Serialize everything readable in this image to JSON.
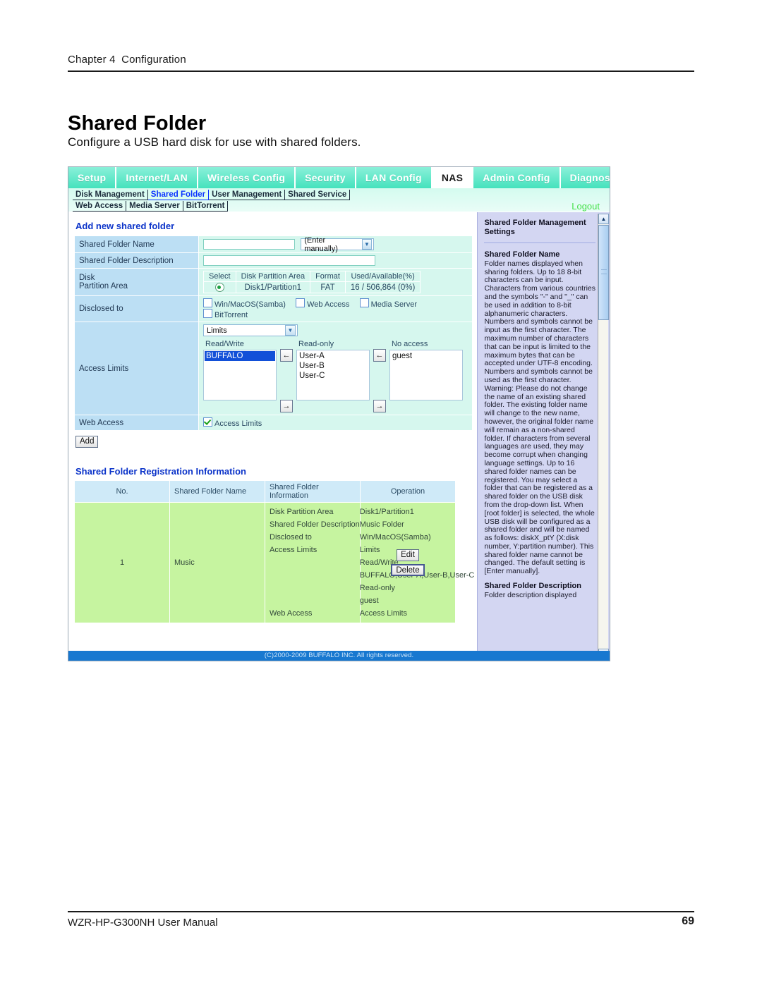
{
  "manual": {
    "running_head_chapter": "Chapter 4",
    "running_head_title": "Configuration",
    "page_title": "Shared Folder",
    "page_subtitle": "Configure a USB hard disk for use with shared folders.",
    "footer_left": "WZR-HP-G300NH User Manual",
    "footer_page": "69"
  },
  "ui": {
    "main_tabs": [
      {
        "label": "Setup",
        "active": false
      },
      {
        "label": "Internet/LAN",
        "active": false
      },
      {
        "label": "Wireless Config",
        "active": false
      },
      {
        "label": "Security",
        "active": false
      },
      {
        "label": "LAN Config",
        "active": false
      },
      {
        "label": "NAS",
        "active": true
      },
      {
        "label": "Admin Config",
        "active": false
      },
      {
        "label": "Diagnostic",
        "active": false
      }
    ],
    "sub_tabs_row1": [
      {
        "label": "Disk Management",
        "active": false
      },
      {
        "label": "Shared Folder",
        "active": true
      },
      {
        "label": "User Management",
        "active": false
      },
      {
        "label": "Shared Service",
        "active": false
      }
    ],
    "sub_tabs_row2": [
      {
        "label": "Web Access",
        "active": false
      },
      {
        "label": "Media Server",
        "active": false
      },
      {
        "label": "BitTorrent",
        "active": false
      }
    ],
    "logout_label": "Logout",
    "copyright": "(C)2000-2009 BUFFALO INC. All rights reserved.",
    "form": {
      "section_title": "Add new shared folder",
      "folder_name_label": "Shared Folder Name",
      "folder_name_value": "",
      "folder_name_select": "(Enter manually)",
      "folder_desc_label": "Shared Folder Description",
      "folder_desc_value": "",
      "disk_label_line1": "Disk",
      "disk_label_line2": "Partition Area",
      "disk_headers": [
        "Select",
        "Disk Partition Area",
        "Format",
        "Used/Available(%)"
      ],
      "disk_row": {
        "partition": "Disk1/Partition1",
        "format": "FAT",
        "used_available": "16 / 506,864 (0%)"
      },
      "disclosed_label": "Disclosed to",
      "disclosed_options": [
        {
          "label": "Win/MacOS(Samba)",
          "checked": false
        },
        {
          "label": "Web Access",
          "checked": false
        },
        {
          "label": "Media Server",
          "checked": false
        },
        {
          "label": "BitTorrent",
          "checked": false
        }
      ],
      "access_limits_label": "Access Limits",
      "access_limits_select": "Limits",
      "col_readwrite": "Read/Write",
      "col_readonly": "Read-only",
      "col_noaccess": "No access",
      "readwrite_list": [
        "BUFFALO"
      ],
      "readwrite_selected": "BUFFALO",
      "readonly_list": [
        "User-A",
        "User-B",
        "User-C"
      ],
      "noaccess_list": [
        "guest"
      ],
      "arrow_left": "←",
      "arrow_right": "→",
      "web_access_label": "Web Access",
      "web_access_option": "Access Limits",
      "web_access_checked": true,
      "add_button": "Add"
    },
    "registration": {
      "section_title": "Shared Folder Registration Information",
      "headers": [
        "No.",
        "Shared Folder Name",
        "Shared Folder Information",
        "Operation"
      ],
      "rows": [
        {
          "no": "1",
          "name": "Music",
          "info": [
            {
              "key": "Disk Partition Area",
              "value": "Disk1/Partition1"
            },
            {
              "key": "Shared Folder Description",
              "value": "Music Folder"
            },
            {
              "key": "Disclosed to",
              "value": "Win/MacOS(Samba)"
            },
            {
              "key": "Access Limits",
              "value": "Limits"
            },
            {
              "key": "",
              "value": "Read/Write"
            },
            {
              "key": "",
              "value": "BUFFALO,User-A,User-B,User-C"
            },
            {
              "key": "",
              "value": "Read-only"
            },
            {
              "key": "",
              "value": "guest"
            },
            {
              "key": "Web Access",
              "value": "Access Limits"
            }
          ],
          "edit_button": "Edit",
          "delete_button": "Delete"
        }
      ]
    },
    "help": {
      "heading": "Shared Folder Management Settings",
      "sections": [
        {
          "title": "Shared Folder Name",
          "body": "Folder names displayed when sharing folders. Up to 18 8-bit characters can be input. Characters from various countries and the symbols \"-\" and \"_\" can be used in addition to 8-bit alphanumeric characters. Numbers and symbols cannot be input as the first character. The maximum number of characters that can be input is limited to the maximum bytes that can be accepted under UTF-8 encoding.\nNumbers and symbols cannot be used as the first character.\nWarning:\nPlease do not change the name of an existing shared folder. The existing folder name will change to the new name, however, the original folder name will remain as a non-shared folder.\nIf characters from several languages are used, they may become corrupt when changing language settings.\nUp to 16 shared folder names can be registered.\n\nYou may select a folder that can be registered as a shared folder on the USB disk from the drop-down list. When [root folder] is selected, the whole USB disk will be configured as a shared folder and will be named as follows: diskX_ptY (X:disk number, Y:partition number). This shared folder name cannot be changed. The default setting is [Enter manually]."
        },
        {
          "title": "Shared Folder Description",
          "body": "Folder description displayed"
        }
      ]
    }
  },
  "colors": {
    "tab_teal": "#49e3bf",
    "label_blue": "#bcdff4",
    "value_mint": "#d6f7ee",
    "table_green": "#c6f4a0",
    "table_head_blue": "#cfeaf8",
    "help_lavender": "#d3d6f2",
    "accent_link_blue": "#0b33c9",
    "logout_green": "#44e04a",
    "copybar_blue": "#1878d0",
    "selection_blue": "#1250d8"
  }
}
